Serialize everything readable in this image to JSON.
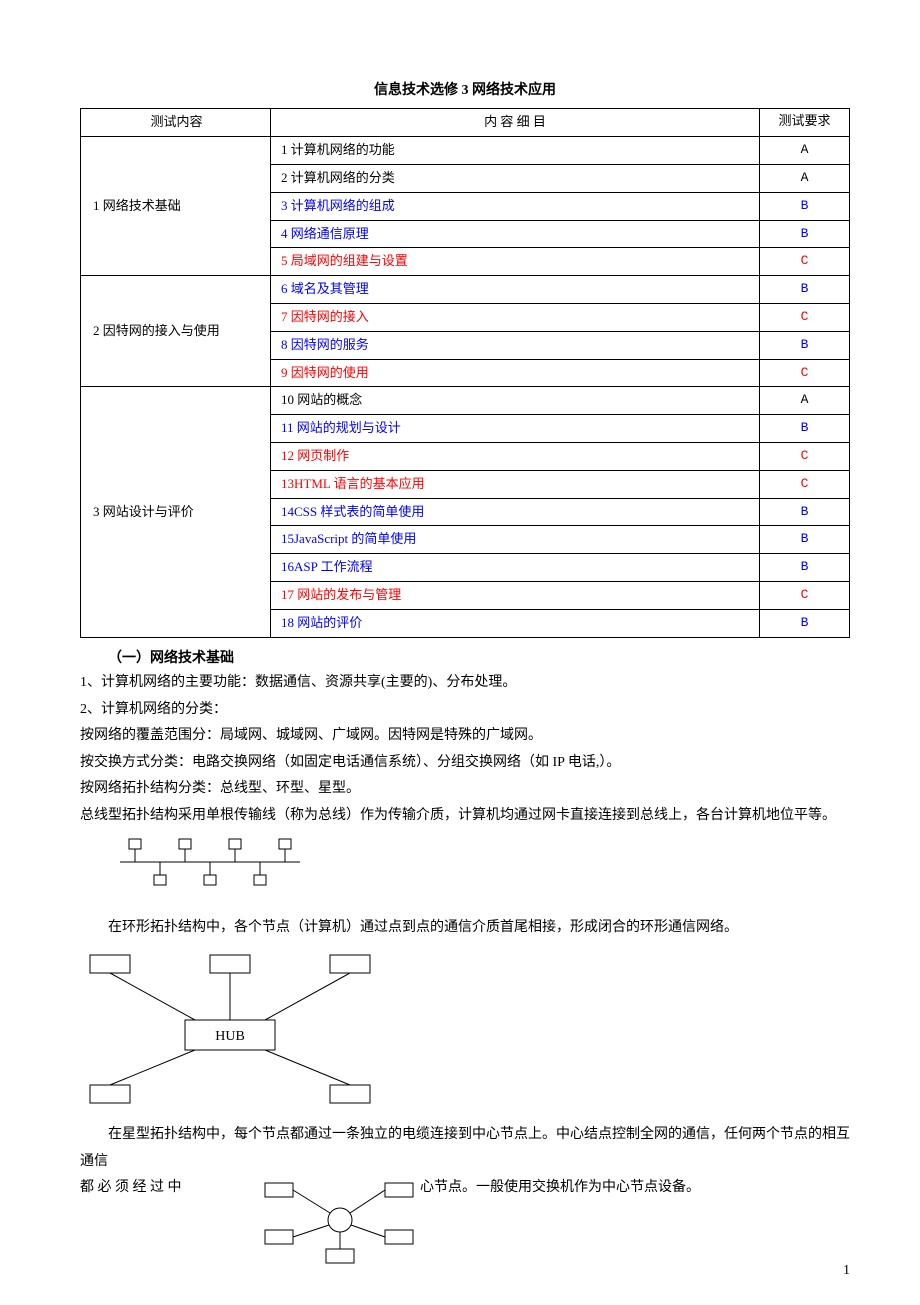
{
  "title": "信息技术选修 3 网络技术应用",
  "table": {
    "headers": [
      "测试内容",
      "内 容 细 目",
      "测试要求"
    ],
    "groups": [
      {
        "category": "1 网络技术基础",
        "rows": [
          {
            "detail": "1 计算机网络的功能",
            "req": "A",
            "color": "black",
            "reqColor": "black"
          },
          {
            "detail": "2 计算机网络的分类",
            "req": "A",
            "color": "black",
            "reqColor": "black"
          },
          {
            "detail": "3 计算机网络的组成",
            "req": "B",
            "color": "blue",
            "reqColor": "blue"
          },
          {
            "detail": "4 网络通信原理",
            "req": "B",
            "color": "blue",
            "reqColor": "blue"
          },
          {
            "detail": "5 局域网的组建与设置",
            "req": "C",
            "color": "red",
            "reqColor": "red"
          }
        ]
      },
      {
        "category": "2 因特网的接入与使用",
        "rows": [
          {
            "detail": "6 域名及其管理",
            "req": "B",
            "color": "blue",
            "reqColor": "blue"
          },
          {
            "detail": "7 因特网的接入",
            "req": "C",
            "color": "red",
            "reqColor": "red"
          },
          {
            "detail": "8 因特网的服务",
            "req": "B",
            "color": "blue",
            "reqColor": "blue"
          },
          {
            "detail": "9 因特网的使用",
            "req": "C",
            "color": "red",
            "reqColor": "red"
          }
        ]
      },
      {
        "category": "3 网站设计与评价",
        "rows": [
          {
            "detail": "10 网站的概念",
            "req": "A",
            "color": "black",
            "reqColor": "black"
          },
          {
            "detail": "11 网站的规划与设计",
            "req": "B",
            "color": "blue",
            "reqColor": "blue"
          },
          {
            "detail": "12 网页制作",
            "req": "C",
            "color": "red",
            "reqColor": "red"
          },
          {
            "detail": "13HTML 语言的基本应用",
            "req": "C",
            "color": "red",
            "reqColor": "red"
          },
          {
            "detail": "14CSS 样式表的简单使用",
            "req": "B",
            "color": "blue",
            "reqColor": "blue"
          },
          {
            "detail": "15JavaScript 的简单使用",
            "req": "B",
            "color": "blue",
            "reqColor": "blue"
          },
          {
            "detail": "16ASP 工作流程",
            "req": "B",
            "color": "blue",
            "reqColor": "blue"
          },
          {
            "detail": "17 网站的发布与管理",
            "req": "C",
            "color": "red",
            "reqColor": "red"
          },
          {
            "detail": "18 网站的评价",
            "req": "B",
            "color": "blue",
            "reqColor": "blue"
          }
        ]
      }
    ]
  },
  "sectionHeading": "（一）网络技术基础",
  "para1": "1、计算机网络的主要功能：数据通信、资源共享(主要的)、分布处理。",
  "para2": "2、计算机网络的分类：",
  "para3": "按网络的覆盖范围分：局域网、城域网、广域网。因特网是特殊的广域网。",
  "para4": "按交换方式分类：电路交换网络（如固定电话通信系统）、分组交换网络（如 IP 电话,）。",
  "para5": "按网络拓扑结构分类：总线型、环型、星型。",
  "para6": "总线型拓扑结构采用单根传输线（称为总线）作为传输介质，计算机均通过网卡直接连接到总线上，各台计算机地位平等。",
  "para7": "在环形拓扑结构中，各个节点（计算机）通过点到点的通信介质首尾相接，形成闭合的环形通信网络。",
  "para8a": "在星型拓扑结构中，每个节点都通过一条独立的电缆连接到中心节点上。中心结点控制全网的通信，任何两个节点的相互通信",
  "para8b_left": "都 必 须 经 过 中",
  "para8b_right": "心节点。一般使用交换机作为中心节点设备。",
  "hubLabel": "HUB",
  "pageNumber": "1"
}
